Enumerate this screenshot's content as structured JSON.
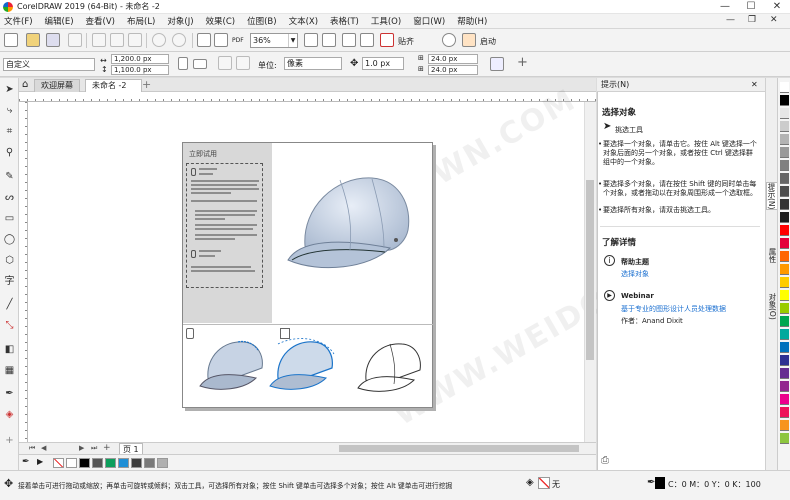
{
  "title_bar": {
    "title": "CorelDRAW 2019 (64-Bit) - 未命名 -2",
    "minimize": "—",
    "maximize": "☐",
    "close": "✕"
  },
  "menu": [
    "文件(F)",
    "编辑(E)",
    "查看(V)",
    "布局(L)",
    "对象(J)",
    "效果(C)",
    "位图(B)",
    "文本(X)",
    "表格(T)",
    "工具(O)",
    "窗口(W)",
    "帮助(H)"
  ],
  "menu_window_controls": {
    "minimize": "—",
    "restore": "❐",
    "close": "✕"
  },
  "toolbar": {
    "zoom": "36%",
    "snap_label": "贴齐",
    "launch_label": "启动",
    "pdf_label": "PDF"
  },
  "property_bar": {
    "preset": "自定义",
    "width": "1,200.0 px",
    "height": "1,100.0 px",
    "unit_label": "单位:",
    "unit_value": "像素",
    "nudge": "1.0 px",
    "dup_x": "24.0 px",
    "dup_y": "24.0 px",
    "add_symbol": "+"
  },
  "tabs": [
    {
      "label": "欢迎屏幕"
    },
    {
      "label": "未命名 -2"
    }
  ],
  "tab_add": "+",
  "page_nav": {
    "page_label": "页 1"
  },
  "doc_text": {
    "heading": "立即试用",
    "tool_caption": "挑选工具\n选择对象"
  },
  "docker": {
    "title": "提示(N)",
    "section_title": "选择对象",
    "tool_name": "挑选工具",
    "bullets": [
      "要选择一个对象，请单击它。按住 Alt 键选择一个对象后面的另一个对象，或者按住 Ctrl 键选择群组中的一个对象。",
      "要选择多个对象，请在按住 Shift 键的同时单击每个对象，或者拖动以在对象周围形成一个选取框。",
      "要选择所有对象，请双击挑选工具。"
    ],
    "learn_more": "了解详情",
    "help_title": "帮助主题",
    "help_link": "选择对象",
    "webinar_title": "Webinar",
    "webinar_link": "基于专业的图形设计人员处理数据",
    "webinar_author": "作者：Anand Dixit",
    "side_tabs": [
      "提示(N)",
      "属性",
      "对象(O)"
    ]
  },
  "status_bar": {
    "hint": "接着单击可进行拖动或缩放；再单击可旋转或倾斜；双击工具，可选择所有对象；按住 Shift 键单击可选择多个对象；按住 Alt 键单击可进行挖掘",
    "fill_none": "无",
    "color_values": "C：0 M：0 Y：0 K：100"
  },
  "palette_colors": [
    "#ffffff",
    "#000000",
    "#e6e6e6",
    "#cccccc",
    "#b3b3b3",
    "#999999",
    "#808080",
    "#666666",
    "#4d4d4d",
    "#333333",
    "#1a1a1a",
    "#ff0000",
    "#e4003a",
    "#ff6600",
    "#ff9900",
    "#ffcc00",
    "#ffff00",
    "#99cc00",
    "#00a651",
    "#00a99d",
    "#0072bc",
    "#2e3192",
    "#662d91",
    "#92278f",
    "#ec008c",
    "#ed145b",
    "#f7941d",
    "#8dc63f"
  ],
  "doc_palette": [
    "#ffffff",
    "#000000",
    "#555555",
    "#0d9e5c",
    "#1f8fd6",
    "#3d3d3d",
    "#7a7a7a",
    "#b0b0b0"
  ],
  "watermark": "WWW.WEIDOWN.COM"
}
